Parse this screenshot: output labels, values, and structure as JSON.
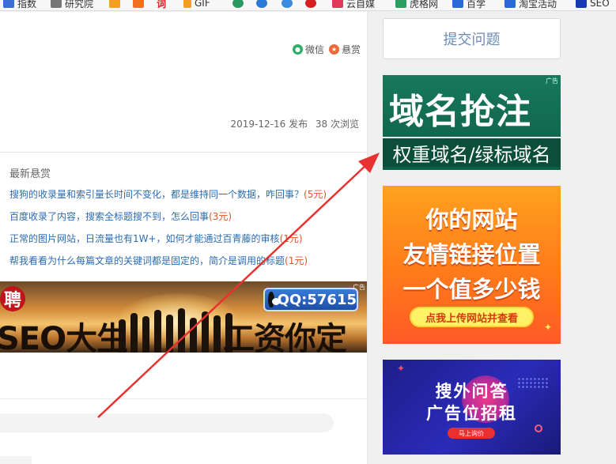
{
  "bookmarks": [
    {
      "label": "指数",
      "icon": "paw-icon",
      "color": "#3b6fd6"
    },
    {
      "label": "研究院",
      "icon": "blog-icon",
      "color": "#555555"
    },
    {
      "label": "",
      "icon": "y-icon",
      "color": "#f4a020"
    },
    {
      "label": "",
      "icon": "fork-icon",
      "color": "#f07020"
    },
    {
      "label": "词",
      "icon": "ci-icon",
      "color": "#d42020"
    },
    {
      "label": "GIF",
      "icon": "lightning-icon",
      "color": "#f0a020"
    },
    {
      "label": "",
      "icon": "globe-icon",
      "color": "#2a9a60"
    },
    {
      "label": "",
      "icon": "search-360-icon",
      "color": "#2a7ad6"
    },
    {
      "label": "",
      "icon": "seven-icon",
      "color": "#3a8ae0"
    },
    {
      "label": "",
      "icon": "emblem-icon",
      "color": "#d42020"
    },
    {
      "label": "云自媒",
      "icon": "cloud-icon",
      "color": "#e03a5a"
    },
    {
      "label": "虎格网",
      "icon": "tiger-icon",
      "color": "#2aa060"
    },
    {
      "label": "百学",
      "icon": "book-icon",
      "color": "#2a6ad6"
    },
    {
      "label": "淘宝活动",
      "icon": "z-icon",
      "color": "#2a6ad6"
    },
    {
      "label": "SEO",
      "icon": "z-icon",
      "color": "#1a3ab0"
    }
  ],
  "share": {
    "wechat": "微信",
    "reward": "悬赏"
  },
  "meta": {
    "date": "2019-12-16 发布",
    "views": "38 次浏览"
  },
  "rewards": {
    "title": "最新悬赏",
    "items": [
      {
        "text": "搜狗的收录量和索引量长时间不变化，都是维持同一个数据，咋回事？",
        "amount": "(5元)"
      },
      {
        "text": "百度收录了内容，搜索全标题搜不到，怎么回事",
        "amount": "(3元)"
      },
      {
        "text": "正常的图片网站，日流量也有1W+，如何才能通过百青藤的审核",
        "amount": "(1元)"
      },
      {
        "text": "帮我看看为什么每篇文章的关键词都是固定的，简介是调用的标题",
        "amount": "(1元)"
      }
    ]
  },
  "banner_seo": {
    "hire": "聘",
    "left_text": "SEO大生",
    "right_text": "工资你定",
    "qq": "QQ:57615",
    "ad_tag": "广告"
  },
  "sidebar": {
    "submit_label": "提交问题",
    "ad_domain": {
      "big": "域名抢注",
      "small": "权重域名/绿标域名",
      "ad_tag": "广告"
    },
    "ad_friend": {
      "line1": "你的网站",
      "line2": "友情链接位置",
      "line3": "一个值多少钱",
      "cta": "点我上传网站并查看"
    },
    "ad_sousuo": {
      "line1": "搜外问答",
      "line2": "广告位招租",
      "button": "马上询价"
    }
  },
  "colors": {
    "link": "#2b6cb0",
    "amount": "#e0562b",
    "arrow": "#e8322f"
  }
}
